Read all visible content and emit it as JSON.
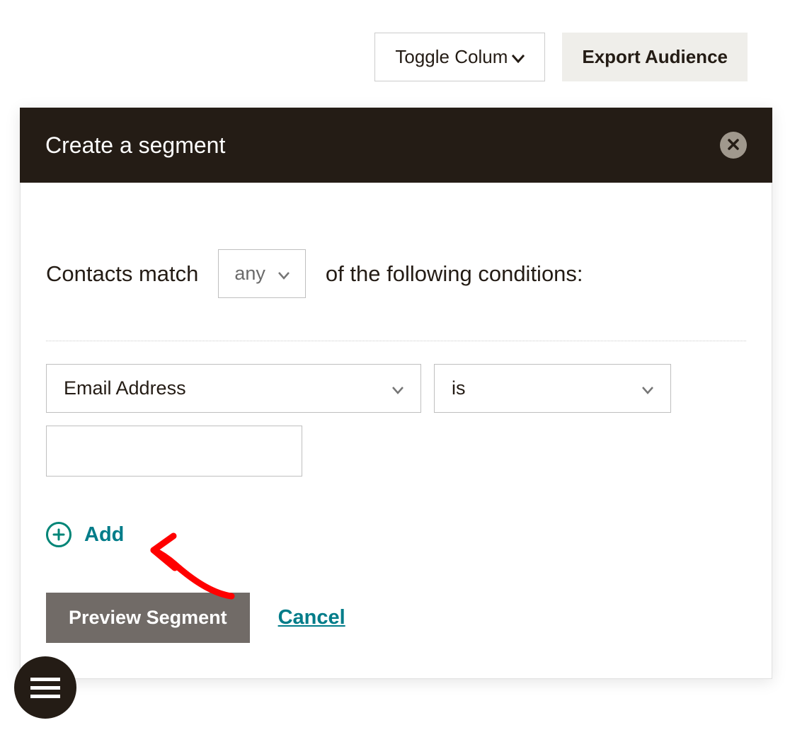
{
  "toolbar": {
    "toggle_columns_label": "Toggle Colum",
    "export_label": "Export Audience"
  },
  "modal": {
    "title": "Create a segment",
    "match_prefix": "Contacts match",
    "match_selector": "any",
    "match_suffix": "of the following conditions:",
    "condition": {
      "field": "Email Address",
      "operator": "is",
      "value": ""
    },
    "add_label": "Add",
    "preview_label": "Preview Segment",
    "cancel_label": "Cancel"
  }
}
